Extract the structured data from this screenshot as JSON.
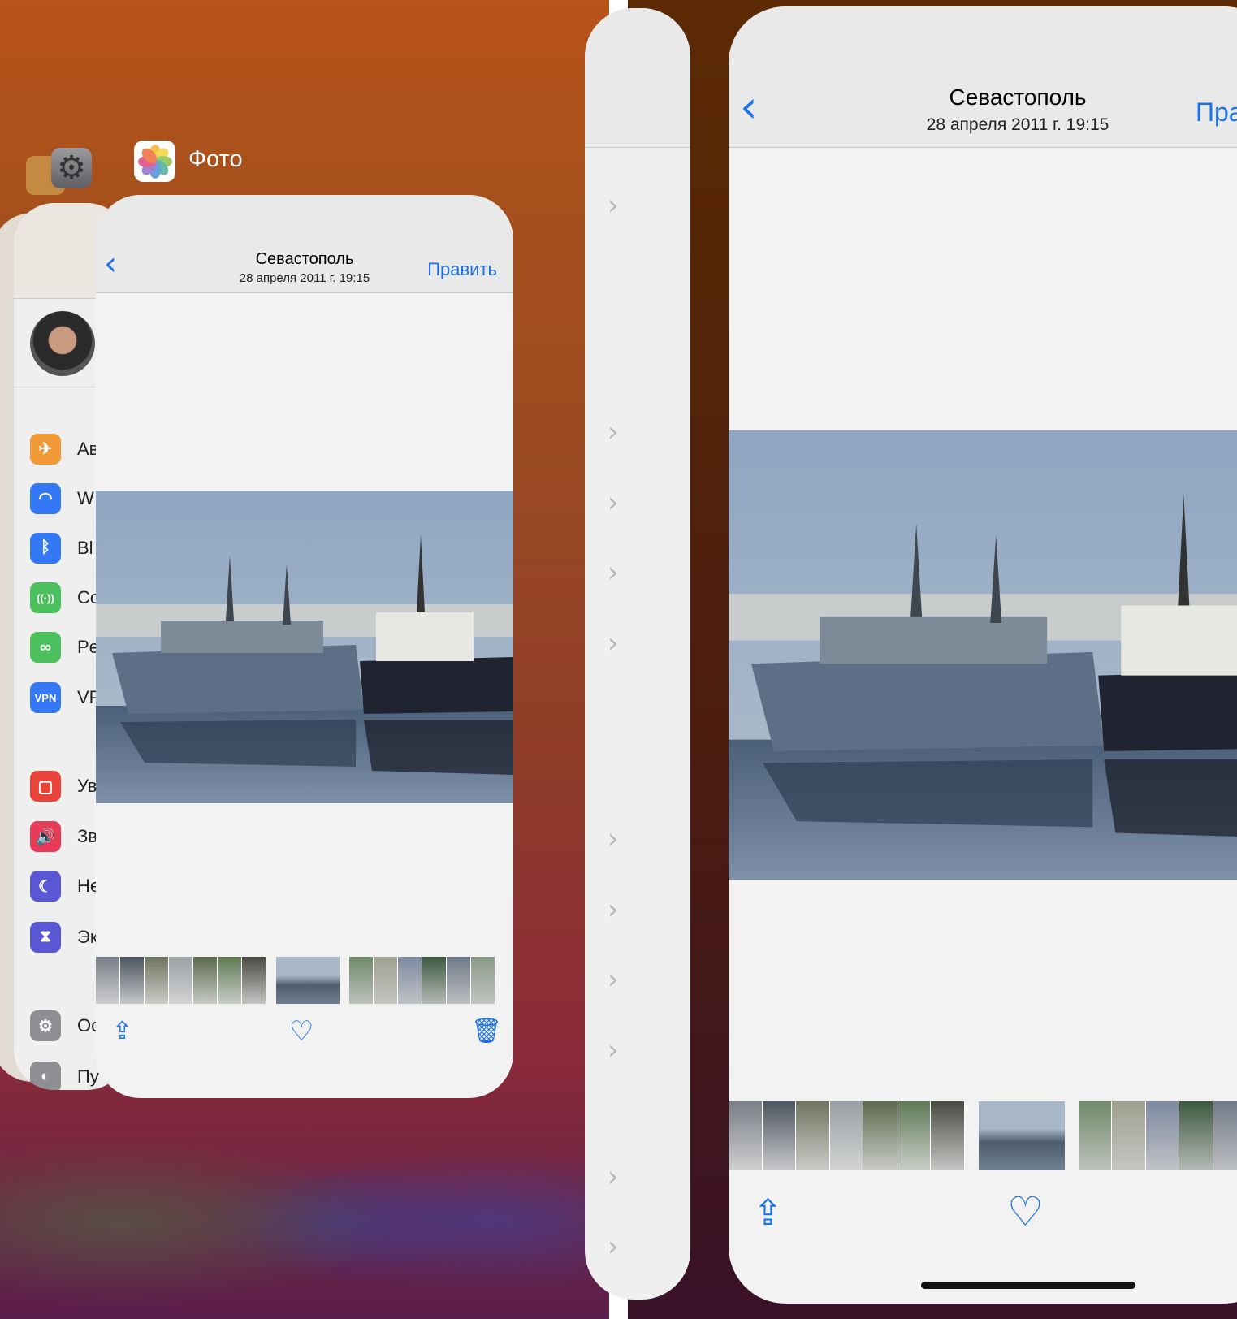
{
  "switcher": {
    "app_label": "Фото"
  },
  "photo": {
    "title": "Севастополь",
    "date": "28 апреля 2011 г.  19:15",
    "edit_label": "Править",
    "edit_label_clipped": "Пра"
  },
  "settings_rows": [
    {
      "label": "Ав",
      "icon": "airplane-icon",
      "color": "#f19a37",
      "glyph": "✈"
    },
    {
      "label": "W",
      "icon": "wifi-icon",
      "color": "#3478f6",
      "glyph": "◠"
    },
    {
      "label": "Bl",
      "icon": "bluetooth-icon",
      "color": "#3478f6",
      "glyph": "ᛒ"
    },
    {
      "label": "Co",
      "icon": "cellular-icon",
      "color": "#4cc05c",
      "glyph": "((·))"
    },
    {
      "label": "Pe",
      "icon": "hotspot-icon",
      "color": "#4cc05c",
      "glyph": "∞"
    },
    {
      "label": "VP",
      "icon": "vpn-icon",
      "color": "#3478f6",
      "glyph": "VPN"
    },
    {
      "label": "Ув",
      "icon": "notifications-icon",
      "color": "#e9443a",
      "glyph": "▢"
    },
    {
      "label": "Зв",
      "icon": "sounds-icon",
      "color": "#e63c58",
      "glyph": "🔊"
    },
    {
      "label": "Не",
      "icon": "moon-icon",
      "color": "#5a57d4",
      "glyph": "☾"
    },
    {
      "label": "Эк",
      "icon": "hourglass-icon",
      "color": "#5a57d4",
      "glyph": "⧗"
    },
    {
      "label": "Ос",
      "icon": "gear-icon",
      "color": "#8e8e93",
      "glyph": "⚙"
    },
    {
      "label": "Пу",
      "icon": "toggles-icon",
      "color": "#8e8e93",
      "glyph": "◐"
    }
  ],
  "thumb_colors": [
    "#7a7f86",
    "#4d5560",
    "#6f7560",
    "#9aa0a3",
    "#5d6a4e",
    "#5f7a55",
    "#4a4a44"
  ],
  "thumb_colors_2": [
    "#708a6a",
    "#a0a090",
    "#7d8aa0",
    "#3c5a40",
    "#707a88",
    "#8a9a88"
  ]
}
